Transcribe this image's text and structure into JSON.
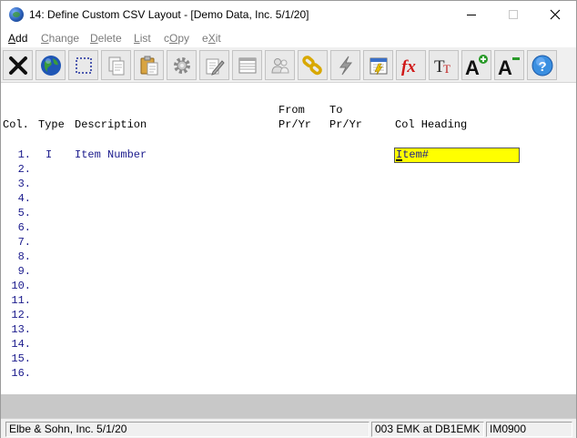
{
  "window": {
    "title": "14: Define Custom CSV Layout - [Demo Data, Inc. 5/1/20]"
  },
  "menu": {
    "items": [
      {
        "label": "Add",
        "acc": "A",
        "rest": "dd",
        "enabled": true
      },
      {
        "label": "Change",
        "acc": "C",
        "rest": "hange",
        "enabled": false
      },
      {
        "label": "Delete",
        "acc": "D",
        "rest": "elete",
        "enabled": false
      },
      {
        "label": "List",
        "acc": "L",
        "rest": "ist",
        "enabled": false
      },
      {
        "label": "cOpy",
        "pre": "c",
        "acc": "O",
        "rest": "py",
        "enabled": false
      },
      {
        "label": "eXit",
        "pre": "e",
        "acc": "X",
        "rest": "it",
        "enabled": false
      }
    ]
  },
  "toolbar": {
    "buttons": [
      "close-x-icon",
      "globe-icon",
      "select-box-icon",
      "copy-pages-icon",
      "clipboard-icon",
      "gear-icon",
      "edit-pencil-icon",
      "list-table-icon",
      "people-icon",
      "chain-link-icon",
      "lightning-icon",
      "calendar-icon",
      "fx-formula-icon",
      "font-size-icon",
      "font-increase-icon",
      "font-decrease-icon",
      "help-icon"
    ]
  },
  "colors": {
    "field_blue": "#1a1a8c",
    "heading_field": "#ffff00",
    "fx_red": "#d01818"
  },
  "screen": {
    "header": {
      "col": "Col.",
      "type": "Type",
      "description": "Description",
      "from_line1": "From",
      "from_line2": "Pr/Yr",
      "to_line1": "To",
      "to_line2": "Pr/Yr",
      "col_heading": "Col Heading"
    },
    "rows": [
      {
        "num": "1.",
        "type": "I",
        "description": "Item Number"
      },
      {
        "num": "2."
      },
      {
        "num": "3."
      },
      {
        "num": "4."
      },
      {
        "num": "5."
      },
      {
        "num": "6."
      },
      {
        "num": "7."
      },
      {
        "num": "8."
      },
      {
        "num": "9."
      },
      {
        "num": "10."
      },
      {
        "num": "11."
      },
      {
        "num": "12."
      },
      {
        "num": "13."
      },
      {
        "num": "14."
      },
      {
        "num": "15."
      },
      {
        "num": "16."
      }
    ],
    "heading_value": "Item#"
  },
  "status": {
    "company": "Elbe & Sohn, Inc. 5/1/20",
    "user": "003 EMK at DB1EMK",
    "program": "IM0900"
  }
}
